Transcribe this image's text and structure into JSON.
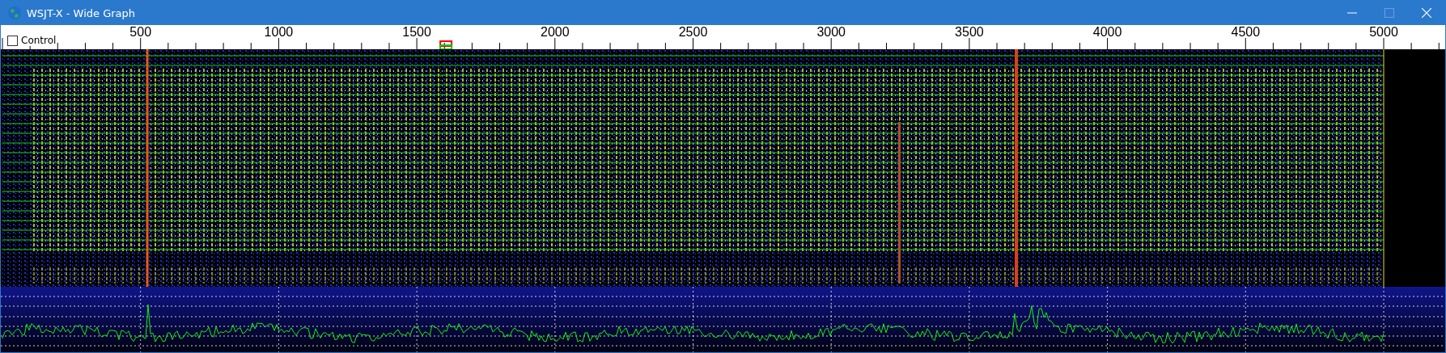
{
  "window": {
    "title": "WSJT-X - Wide Graph"
  },
  "control": {
    "label": "Control",
    "checked": false
  },
  "frequency_scale": {
    "labels": [
      "500",
      "1000",
      "1500",
      "2000",
      "2500",
      "3000",
      "3500",
      "4000",
      "4500",
      "5000"
    ]
  }
}
